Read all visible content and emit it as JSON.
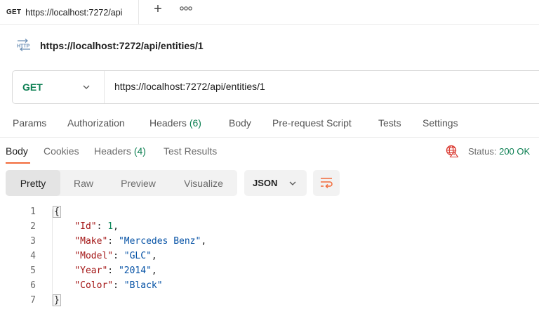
{
  "tab": {
    "method": "GET",
    "title": "https://localhost:7272/api",
    "add_label": "+",
    "more_label": "ooo"
  },
  "request": {
    "title": "https://localhost:7272/api/entities/1",
    "http_icon_label": "HTTP",
    "method": "GET",
    "url": "https://localhost:7272/api/entities/1"
  },
  "request_tabs": [
    {
      "label": "Params"
    },
    {
      "label": "Authorization"
    },
    {
      "label": "Headers",
      "count": "(6)"
    },
    {
      "label": "Body"
    },
    {
      "label": "Pre-request Script"
    },
    {
      "label": "Tests"
    },
    {
      "label": "Settings"
    }
  ],
  "response_tabs": [
    {
      "label": "Body"
    },
    {
      "label": "Cookies"
    },
    {
      "label": "Headers",
      "count": "(4)"
    },
    {
      "label": "Test Results"
    }
  ],
  "status": {
    "label": "Status:",
    "value": "200 OK"
  },
  "format": {
    "buttons": [
      "Pretty",
      "Raw",
      "Preview",
      "Visualize"
    ],
    "selected": "Pretty",
    "language": "JSON"
  },
  "code": {
    "line_numbers": [
      "1",
      "2",
      "3",
      "4",
      "5",
      "6",
      "7"
    ],
    "open_brace": "{",
    "close_brace": "}",
    "entries": [
      {
        "key": "\"Id\"",
        "value": "1",
        "type": "number",
        "comma": ","
      },
      {
        "key": "\"Make\"",
        "value": "\"Mercedes Benz\"",
        "type": "string",
        "comma": ","
      },
      {
        "key": "\"Model\"",
        "value": "\"GLC\"",
        "type": "string",
        "comma": ","
      },
      {
        "key": "\"Year\"",
        "value": "\"2014\"",
        "type": "string",
        "comma": ","
      },
      {
        "key": "\"Color\"",
        "value": "\"Black\"",
        "type": "string",
        "comma": ""
      }
    ]
  },
  "colors": {
    "method_get": "#0c7f52",
    "count_green": "#0c7f52",
    "active_underline": "#f26b3a",
    "json_key": "#a31515",
    "json_string": "#0451a5",
    "json_number": "#098658"
  },
  "icons": {
    "http": "http-icon",
    "globe": "globe-error-icon",
    "wrap": "wrap-lines-icon",
    "chevron": "chevron-down-icon"
  }
}
